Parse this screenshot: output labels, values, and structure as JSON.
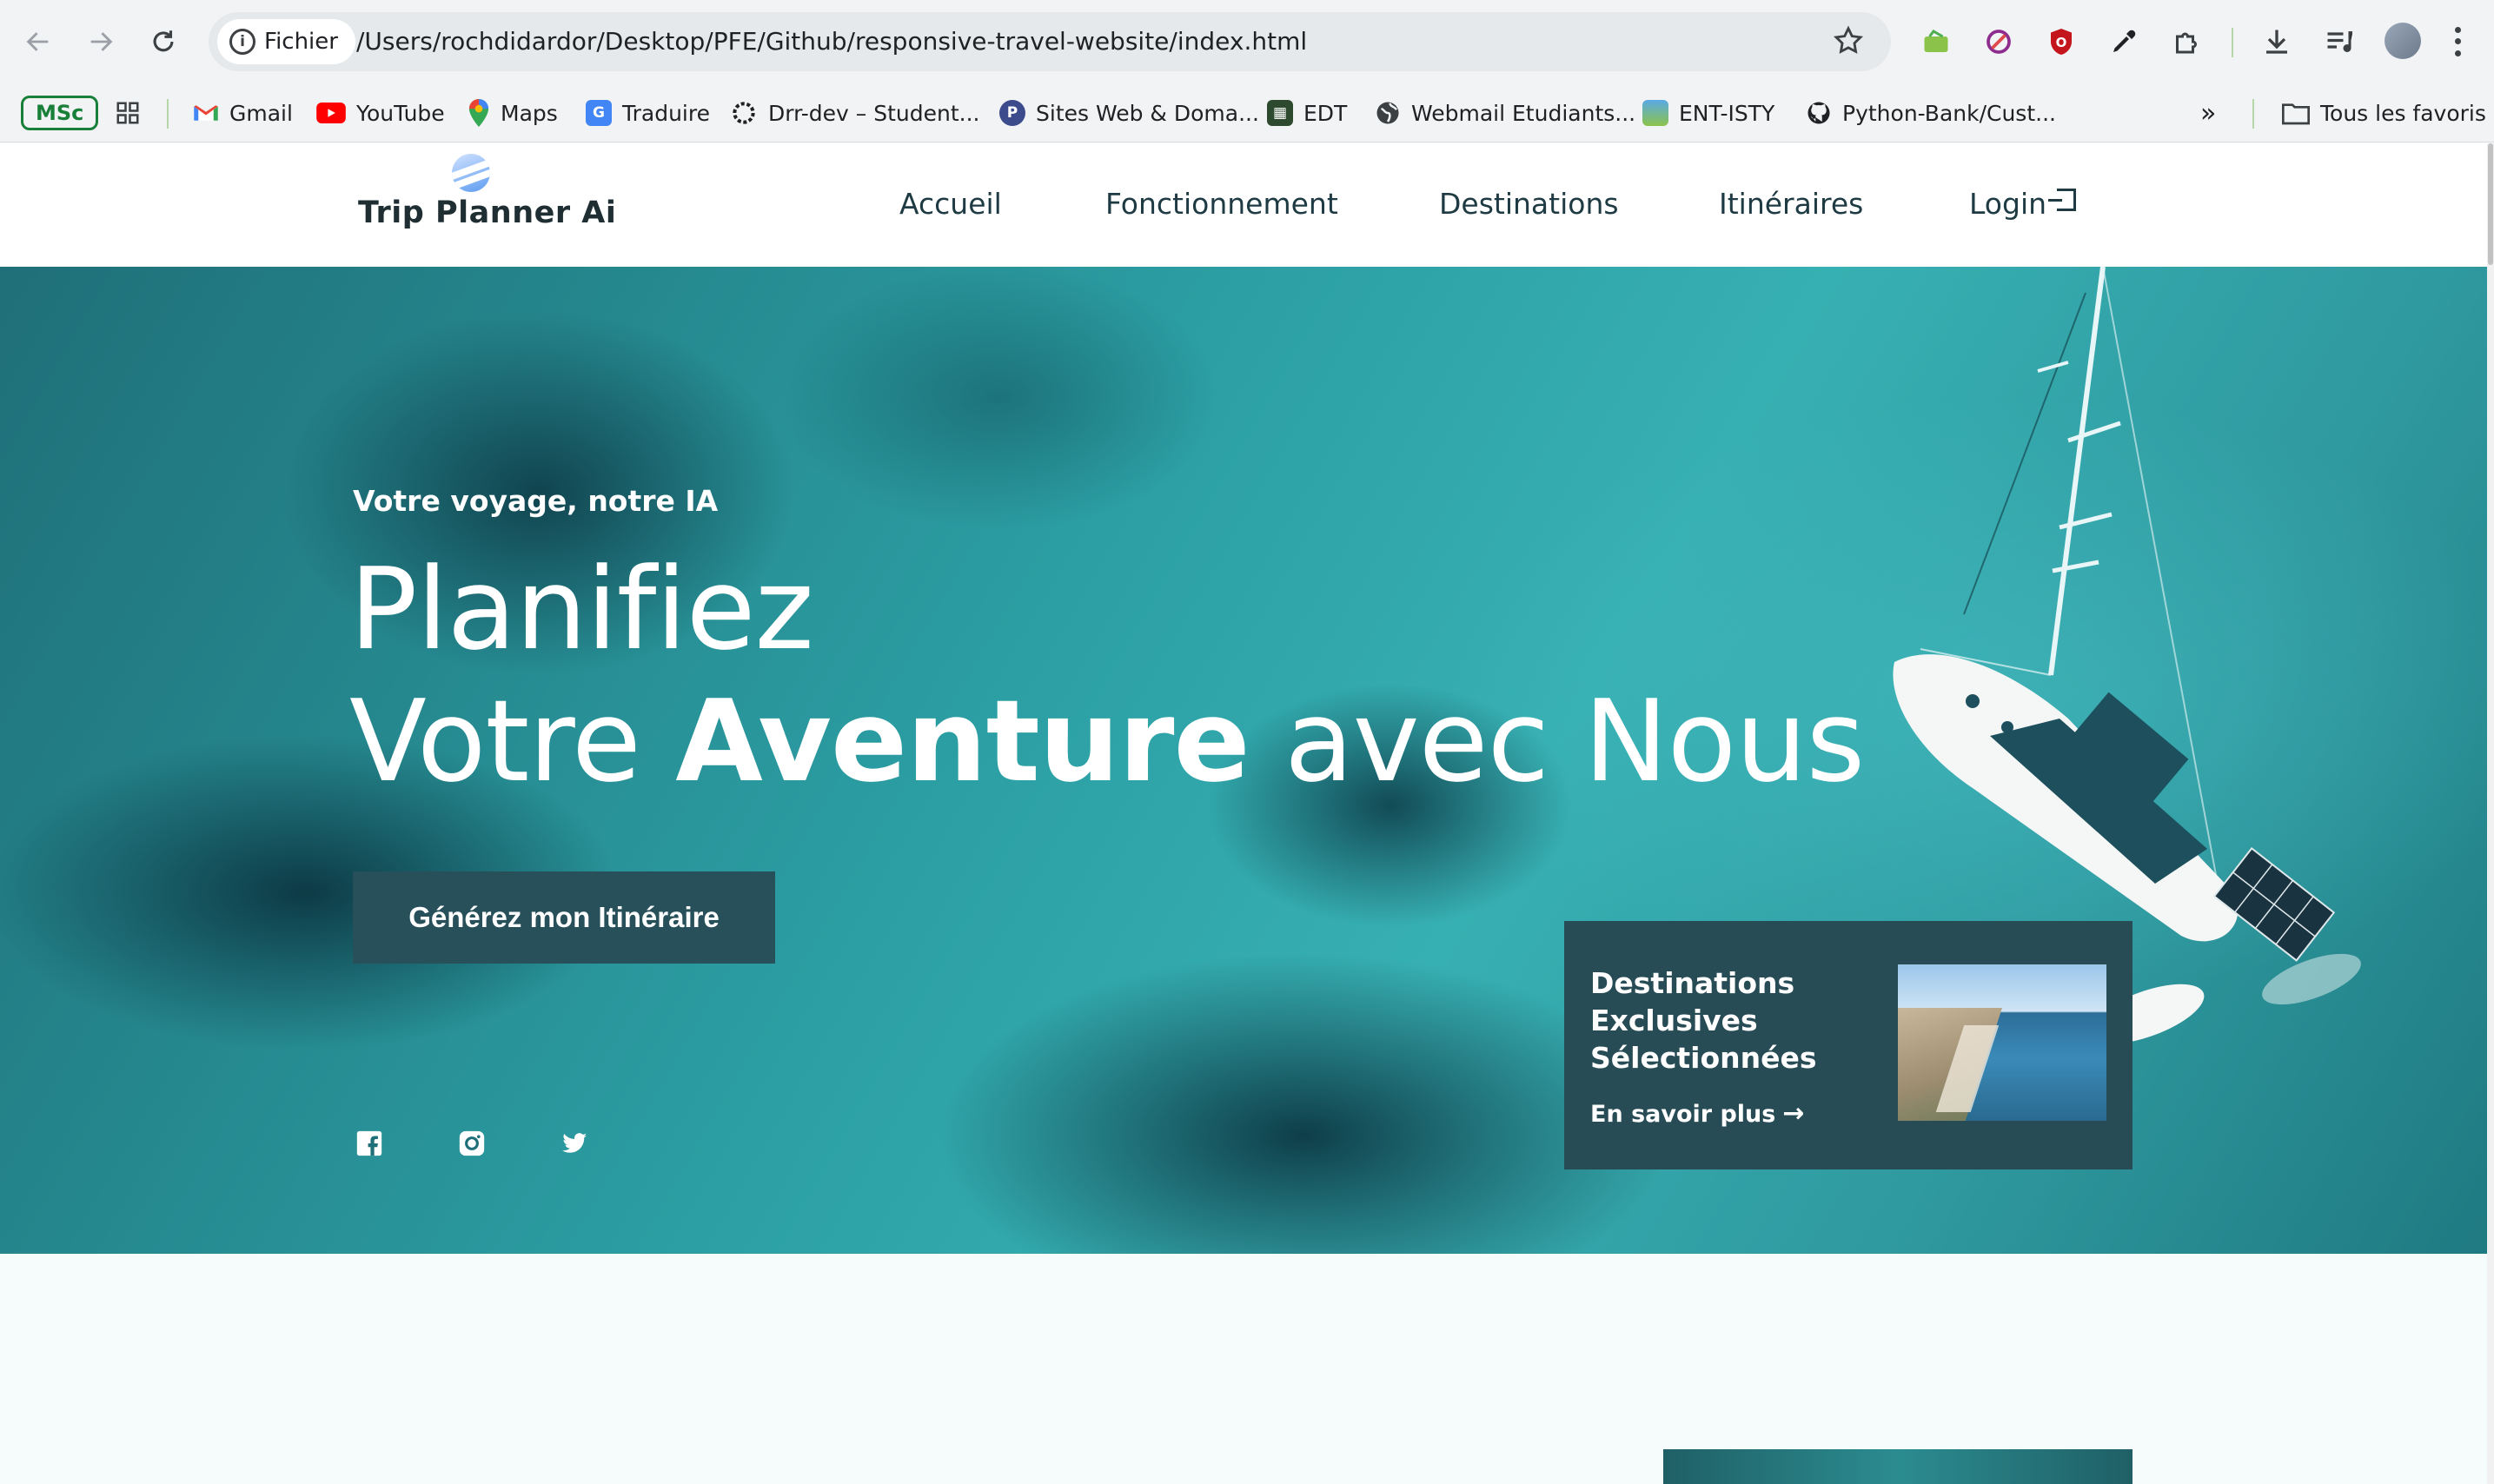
{
  "browser": {
    "site_chip": "Fichier",
    "url": "/Users/rochdidardor/Desktop/PFE/Github/responsive-travel-website/index.html"
  },
  "bookmarks": {
    "msc": "MSc",
    "items": [
      {
        "label": "Gmail",
        "icon": "gmail-icon",
        "color": "#ea4335"
      },
      {
        "label": "YouTube",
        "icon": "youtube-icon",
        "color": "#ff0000"
      },
      {
        "label": "Maps",
        "icon": "maps-icon",
        "color": "#34a853"
      },
      {
        "label": "Traduire",
        "icon": "translate-icon",
        "color": "#4285f4"
      },
      {
        "label": "Drr-dev – Student...",
        "icon": "loader-icon",
        "color": "#202124"
      },
      {
        "label": "Sites Web & Doma...",
        "icon": "p-icon",
        "color": "#3c4b8c"
      },
      {
        "label": "EDT",
        "icon": "calendar-icon",
        "color": "#2e4a2e"
      },
      {
        "label": "Webmail Etudiants...",
        "icon": "globe-icon",
        "color": "#202124"
      },
      {
        "label": "ENT-ISTY",
        "icon": "ent-icon",
        "color": "#5aa9e6"
      },
      {
        "label": "Python-Bank/Cust...",
        "icon": "github-icon",
        "color": "#202124"
      }
    ],
    "all_favorites": "Tous les favoris"
  },
  "site": {
    "logo": "Trip Planner Ai",
    "nav": [
      "Accueil",
      "Fonctionnement",
      "Destinations",
      "Itinéraires",
      "Login"
    ]
  },
  "hero": {
    "kicker": "Votre voyage, notre IA",
    "title_line1": "Planifiez",
    "title_line2_a": "Votre",
    "title_line2_b": "Aventure",
    "title_line2_c": "avec Nous",
    "cta": "Générez mon Itinéraire",
    "socials": [
      "facebook-icon",
      "instagram-icon",
      "twitter-icon"
    ]
  },
  "promo": {
    "title": "Destinations Exclusives Sélectionnées",
    "link": "En savoir plus"
  },
  "colors": {
    "primary_dark": "#27505a",
    "nav_text": "#1e3a43",
    "sea": "#2b9ea3"
  }
}
